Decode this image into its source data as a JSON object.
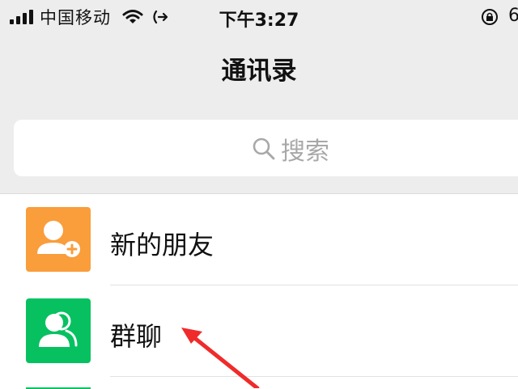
{
  "status_bar": {
    "carrier": "中国移动",
    "time": "下午3:27",
    "battery_fragment": "6"
  },
  "nav": {
    "title": "通讯录"
  },
  "search": {
    "label": "搜索"
  },
  "contacts_menu": [
    {
      "label": "新的朋友",
      "icon": "add-friend-icon",
      "color": "#fa9d3b"
    },
    {
      "label": "群聊",
      "icon": "group-chat-icon",
      "color": "#07c160"
    }
  ],
  "annotation": {
    "arrow_color": "#ef2b2b",
    "target": "群聊"
  }
}
